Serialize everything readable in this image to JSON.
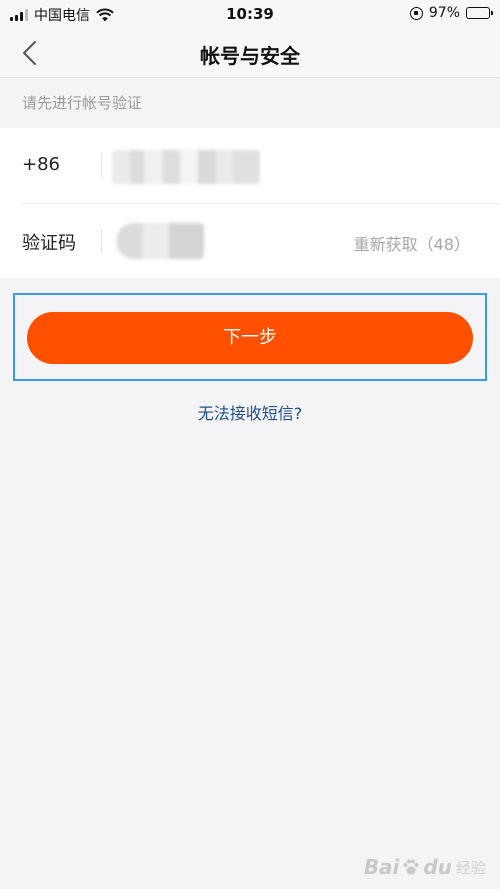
{
  "status_bar": {
    "carrier": "中国电信",
    "time": "10:39",
    "battery_percent": "97%",
    "battery_level": 0.97,
    "icons": [
      "signal-icon",
      "wifi-icon",
      "orientation-lock-icon",
      "battery-icon"
    ]
  },
  "nav": {
    "title": "帐号与安全",
    "back_icon": "chevron-left-icon"
  },
  "form": {
    "hint": "请先进行帐号验证",
    "phone_prefix": "+86",
    "code_label": "验证码",
    "resend_text": "重新获取（48）"
  },
  "actions": {
    "next_label": "下一步",
    "cant_receive_sms": "无法接收短信?"
  },
  "watermark": {
    "brand": "Bai",
    "brand_end": "du",
    "sub": "经验"
  },
  "colors": {
    "primary_button": "#ff5000",
    "link": "#1e4e8c",
    "highlight_border": "#3d9ae6",
    "battery": "#3ec94d"
  }
}
